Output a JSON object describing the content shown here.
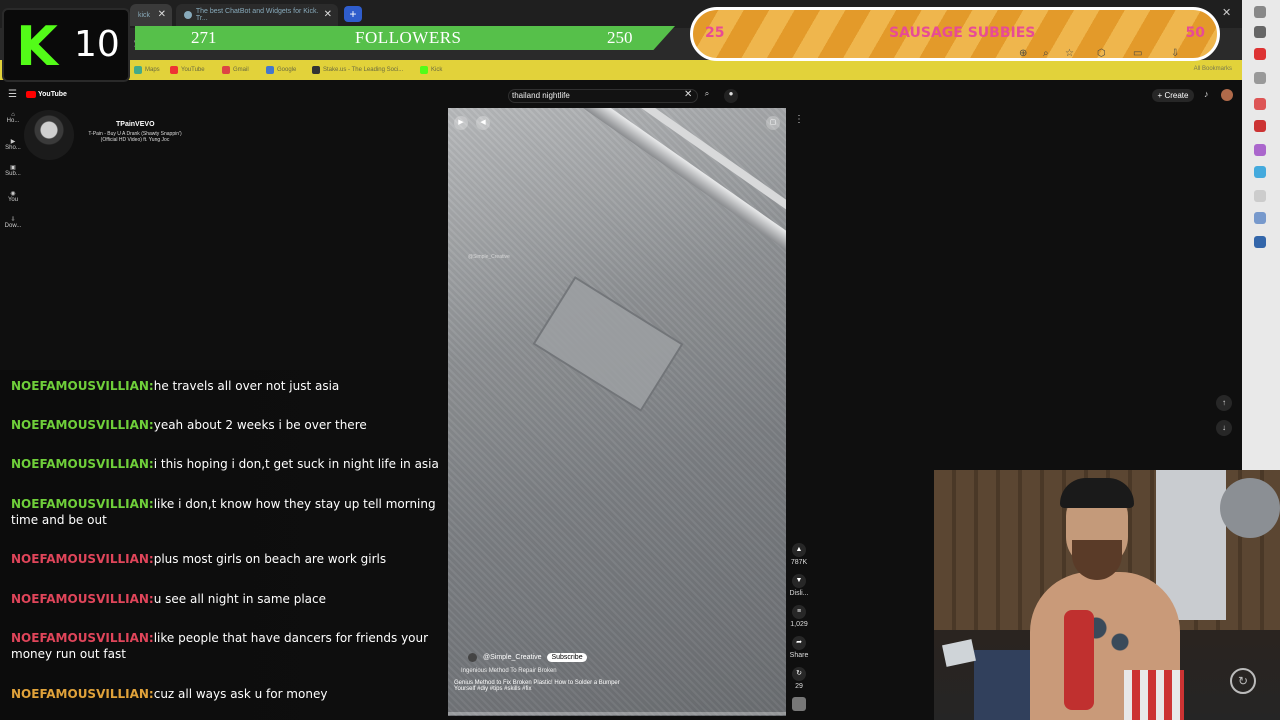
{
  "browser": {
    "tabs": [
      {
        "label": "kick",
        "active": true
      },
      {
        "label": "The best ChatBot and Widgets for Kick. Tr...",
        "active": false
      }
    ],
    "new_tab": "+",
    "url_partial": "yout",
    "bookmarks": [
      "Maps",
      "YouTube",
      "Gmail",
      "Google",
      "Stake.us - The Leading Soci...",
      "Kick"
    ],
    "all_bookmarks": "All Bookmarks"
  },
  "overlay": {
    "kick_letter": "K",
    "kick_count": "10",
    "followers_current": "271",
    "followers_label": "FOLLOWERS",
    "followers_goal": "250",
    "subs_current": "25",
    "subs_label": "SAUSAGE SUBBIES",
    "subs_goal": "50"
  },
  "youtube": {
    "logo": "YouTube",
    "search_value": "thailand nightlife",
    "create_label": "Create",
    "nav": [
      "Ho...",
      "Sho...",
      "Sub...",
      "You",
      "Dow..."
    ],
    "music": {
      "channel": "TPainVEVO",
      "title": "T-Pain - Buy U A Drank (Shawty Snappin') (Official HD Video) ft. Yung Joc"
    },
    "short": {
      "watermark": "@Simple_Creative",
      "channel": "@Simple_Creative",
      "subscribe": "Subscribe",
      "song": "Ingenious Method To Repair Broken",
      "description": "Genius Method to Fix Broken Plastic! How to Solder a Bumper Yourself #diy #tips #skills #fix"
    },
    "actions": {
      "likes": "787K",
      "dislike": "Disli...",
      "comments": "1,029",
      "share": "Share",
      "remix": "29"
    }
  },
  "chat": [
    {
      "user": "NOEFAMOUSVILLIAN:",
      "text": "he travels all over not just asia",
      "color": "#6fcf3a"
    },
    {
      "user": "NOEFAMOUSVILLIAN:",
      "text": "yeah about 2 weeks i be over there",
      "color": "#6fcf3a"
    },
    {
      "user": "NOEFAMOUSVILLIAN:",
      "text": "i this hoping i don,t get suck in night life in asia",
      "color": "#6fcf3a"
    },
    {
      "user": "NOEFAMOUSVILLIAN:",
      "text": "like i don,t know how they stay up tell morning time and be out",
      "color": "#6fcf3a"
    },
    {
      "user": "NOEFAMOUSVILLIAN:",
      "text": "plus most girls on beach are work girls",
      "color": "#e0455a"
    },
    {
      "user": "NOEFAMOUSVILLIAN:",
      "text": "u see all night in same place",
      "color": "#e0455a"
    },
    {
      "user": "NOEFAMOUSVILLIAN:",
      "text": "like people that have dancers for friends your money run out fast",
      "color": "#e0455a"
    },
    {
      "user": "NOEFAMOUSVILLIAN:",
      "text": "cuz all ways ask u for money",
      "color": "#e0a23a"
    }
  ],
  "colors": {
    "kick_green": "#53fc18",
    "followers_bar": "#56c04a",
    "bookmark_bar": "#e2d23a",
    "subs_text": "#e84b95"
  }
}
